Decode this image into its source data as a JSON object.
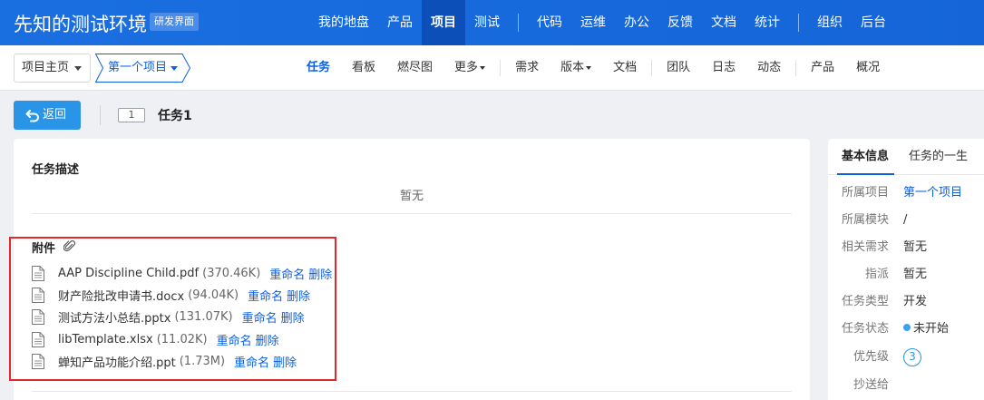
{
  "brand": {
    "title": "先知的测试环境",
    "badge": "研发界面"
  },
  "top_nav": {
    "group1": [
      "我的地盘",
      "产品",
      "项目",
      "测试"
    ],
    "group2": [
      "代码",
      "运维",
      "办公",
      "反馈",
      "文档",
      "统计"
    ],
    "group3": [
      "组织",
      "后台"
    ],
    "active": "项目"
  },
  "breadcrumb": {
    "home": "项目主页",
    "project": "第一个项目"
  },
  "sub_nav": {
    "items": [
      "任务",
      "看板",
      "燃尽图",
      "更多",
      "需求",
      "版本",
      "文档",
      "团队",
      "日志",
      "动态",
      "产品",
      "概况"
    ],
    "active": "任务"
  },
  "toolbar": {
    "back_label": "返回",
    "task_id": "1",
    "task_title": "任务1"
  },
  "main": {
    "description_title": "任务描述",
    "description_empty": "暂无",
    "attachments_title": "附件",
    "rename_label": "重命名",
    "delete_label": "删除",
    "attachments": [
      {
        "name": "AAP Discipline Child.pdf",
        "size": "(370.46K)"
      },
      {
        "name": "财产险批改申请书.docx",
        "size": "(94.04K)"
      },
      {
        "name": "测试方法小总结.pptx",
        "size": "(131.07K)"
      },
      {
        "name": "libTemplate.xlsx",
        "size": "(11.02K)"
      },
      {
        "name": "蝉知产品功能介绍.ppt",
        "size": "(1.73M)"
      }
    ]
  },
  "side": {
    "tabs": [
      "基本信息",
      "任务的一生"
    ],
    "info": [
      {
        "label": "所属项目",
        "value": "第一个项目"
      },
      {
        "label": "所属模块",
        "value": "/"
      },
      {
        "label": "相关需求",
        "value": "暂无"
      },
      {
        "label": "指派",
        "value": "暂无"
      },
      {
        "label": "任务类型",
        "value": "开发"
      },
      {
        "label": "任务状态",
        "value": "未开始"
      },
      {
        "label": "优先级",
        "value": "3"
      },
      {
        "label": "抄送给",
        "value": ""
      }
    ]
  },
  "colors": {
    "primary": "#1a6fe0",
    "link": "#0c60e1",
    "button": "#2a94e6",
    "highlight_box": "#e0282d",
    "status_dot": "#3aa3f0"
  }
}
